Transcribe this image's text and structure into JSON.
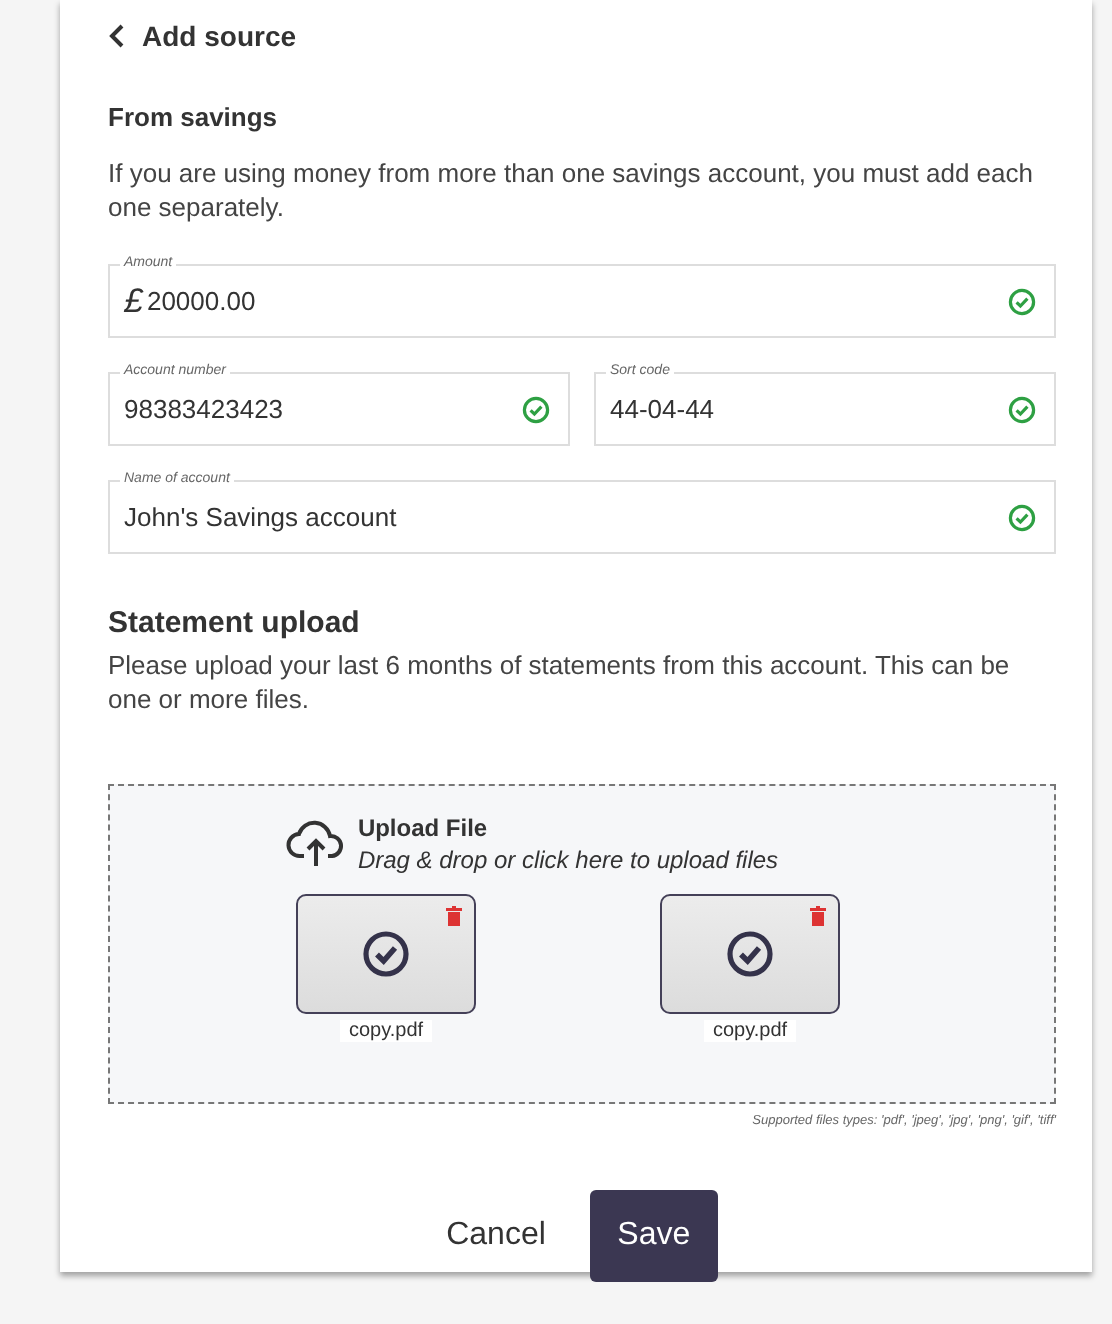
{
  "header": {
    "title": "Add source"
  },
  "section": {
    "title": "From savings",
    "description": "If you are using money from more than one savings account, you must add each one separately."
  },
  "fields": [
    {
      "label": "Amount",
      "prefix": "£",
      "value": "20000.00",
      "valid": true
    },
    {
      "label": "Account number",
      "value": "98383423423",
      "valid": true
    },
    {
      "label": "Sort code",
      "value": "44-04-44",
      "valid": true
    },
    {
      "label": "Name of account",
      "value": "John's Savings account",
      "valid": true
    }
  ],
  "upload": {
    "title": "Statement upload",
    "description": "Please upload your last 6 months of statements from this account. This can be one or more files.",
    "drop_title": "Upload File",
    "drop_hint": "Drag & drop or click here to upload files",
    "files": [
      {
        "name": "copy.pdf",
        "uploaded": true
      },
      {
        "name": "copy.pdf",
        "uploaded": true
      }
    ],
    "supported": "Supported files types: 'pdf', 'jpeg', 'jpg', 'png', 'gif', 'tiff'"
  },
  "buttons": {
    "cancel": "Cancel",
    "save": "Save"
  }
}
